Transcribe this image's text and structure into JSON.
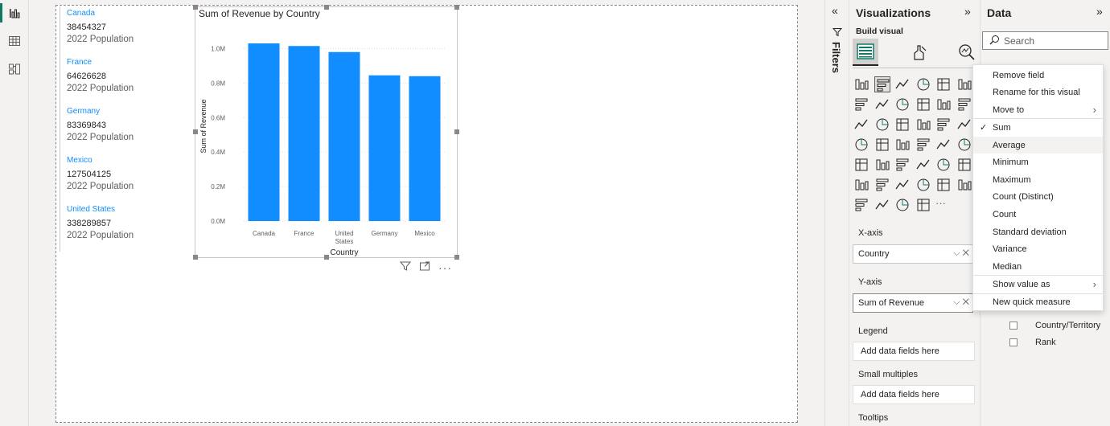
{
  "canvas": {
    "cards": [
      {
        "name": "Canada",
        "value": "38454327",
        "label": "2022 Population"
      },
      {
        "name": "France",
        "value": "64626628",
        "label": "2022 Population"
      },
      {
        "name": "Germany",
        "value": "83369843",
        "label": "2022 Population"
      },
      {
        "name": "Mexico",
        "value": "127504125",
        "label": "2022 Population"
      },
      {
        "name": "United States",
        "value": "338289857",
        "label": "2022 Population"
      }
    ]
  },
  "chart_data": {
    "type": "bar",
    "title": "Sum of Revenue by Country",
    "xlabel": "Country",
    "ylabel": "Sum of Revenue",
    "categories": [
      "Canada",
      "France",
      "United States",
      "Germany",
      "Mexico"
    ],
    "category_display": [
      [
        "Canada"
      ],
      [
        "France"
      ],
      [
        "United",
        "States"
      ],
      [
        "Germany"
      ],
      [
        "Mexico"
      ]
    ],
    "values": [
      1030000,
      1015000,
      980000,
      845000,
      840000
    ],
    "ylim": [
      0,
      1100000
    ],
    "yticks": [
      0,
      200000,
      400000,
      600000,
      800000,
      1000000
    ],
    "ytick_labels": [
      "0.0M",
      "0.2M",
      "0.4M",
      "0.6M",
      "0.8M",
      "1.0M"
    ],
    "color": "#118dff",
    "grid": true
  },
  "filters": {
    "label": "Filters"
  },
  "visualizations": {
    "title": "Visualizations",
    "subtitle": "Build visual",
    "xaxis_label": "X-axis",
    "xaxis_field": "Country",
    "yaxis_label": "Y-axis",
    "yaxis_field": "Sum of Revenue",
    "legend_label": "Legend",
    "legend_placeholder": "Add data fields here",
    "small_multiples_label": "Small multiples",
    "small_multiples_placeholder": "Add data fields here",
    "tooltips_label": "Tooltips",
    "more_glyph": "···"
  },
  "data_pane": {
    "title": "Data",
    "search_placeholder": "Search",
    "fields": [
      "Country/Territory",
      "Rank"
    ]
  },
  "context_menu": {
    "items": [
      {
        "label": "Remove field"
      },
      {
        "label": "Rename for this visual"
      },
      {
        "label": "Move to"
      },
      {
        "label": "Sum"
      },
      {
        "label": "Average"
      },
      {
        "label": "Minimum"
      },
      {
        "label": "Maximum"
      },
      {
        "label": "Count (Distinct)"
      },
      {
        "label": "Count"
      },
      {
        "label": "Standard deviation"
      },
      {
        "label": "Variance"
      },
      {
        "label": "Median"
      },
      {
        "label": "Show value as"
      },
      {
        "label": "New quick measure"
      }
    ]
  },
  "colors": {
    "accent": "#118dff",
    "teal": "#117865"
  }
}
